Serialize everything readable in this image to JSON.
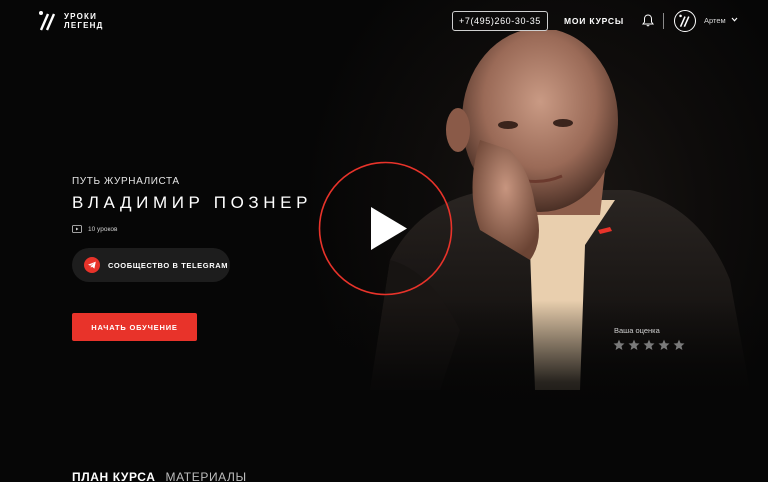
{
  "header": {
    "logo_line1": "УРОКИ",
    "logo_line2": "ЛЕГЕНД",
    "phone": "+7(495)260-30-35",
    "my_courses": "МОИ КУРСЫ",
    "username": "Артем"
  },
  "course": {
    "subtitle": "ПУТЬ ЖУРНАЛИСТА",
    "title": "ВЛАДИМИР ПОЗНЕР",
    "lessons": "10 уроков",
    "telegram_button": "СООБЩЕСТВО В TELEGRAM",
    "start_button": "НАЧАТЬ ОБУЧЕНИЕ"
  },
  "rating": {
    "label": "Ваша оценка",
    "stars_total": 5,
    "stars_filled": 0
  },
  "tabs": [
    {
      "label": "ПЛАН КУРСА"
    },
    {
      "label": "МАТЕРИАЛЫ"
    }
  ],
  "colors": {
    "accent": "#e8332a",
    "background": "#060606",
    "button_dark": "#1d1d1d"
  },
  "icons": [
    "logo-icon",
    "bell-icon",
    "avatar-logo-icon",
    "chevron-down-icon",
    "video-icon",
    "telegram-icon",
    "play-icon",
    "star-icon"
  ]
}
